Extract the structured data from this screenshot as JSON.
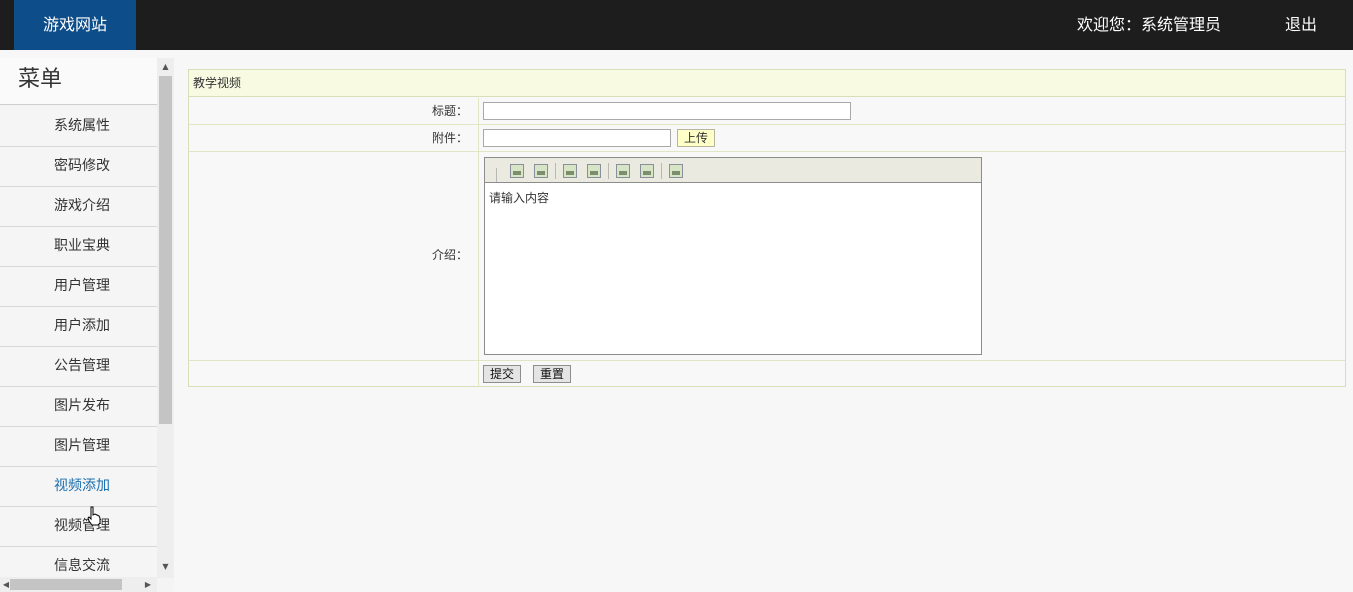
{
  "header": {
    "brand": "游戏网站",
    "welcome": "欢迎您：系统管理员",
    "logout": "退出"
  },
  "sidebar": {
    "title": "菜单",
    "items": [
      {
        "label": "系统属性"
      },
      {
        "label": "密码修改"
      },
      {
        "label": "游戏介绍"
      },
      {
        "label": "职业宝典"
      },
      {
        "label": "用户管理"
      },
      {
        "label": "用户添加"
      },
      {
        "label": "公告管理"
      },
      {
        "label": "图片发布"
      },
      {
        "label": "图片管理"
      },
      {
        "label": "视频添加"
      },
      {
        "label": "视频管理"
      },
      {
        "label": "信息交流"
      }
    ]
  },
  "form": {
    "title": "教学视频",
    "title_label": "标题：",
    "title_value": "",
    "attachment_label": "附件：",
    "attachment_value": "",
    "upload_button": "上传",
    "intro_label": "介绍：",
    "editor_placeholder": "请输入内容",
    "submit_button": "提交",
    "reset_button": "重置"
  },
  "colors": {
    "topbar": "#1d1d1d",
    "brand": "#0d4d8a",
    "active_menu": "#1a6fae",
    "panel_head": "#f8fbe2"
  }
}
